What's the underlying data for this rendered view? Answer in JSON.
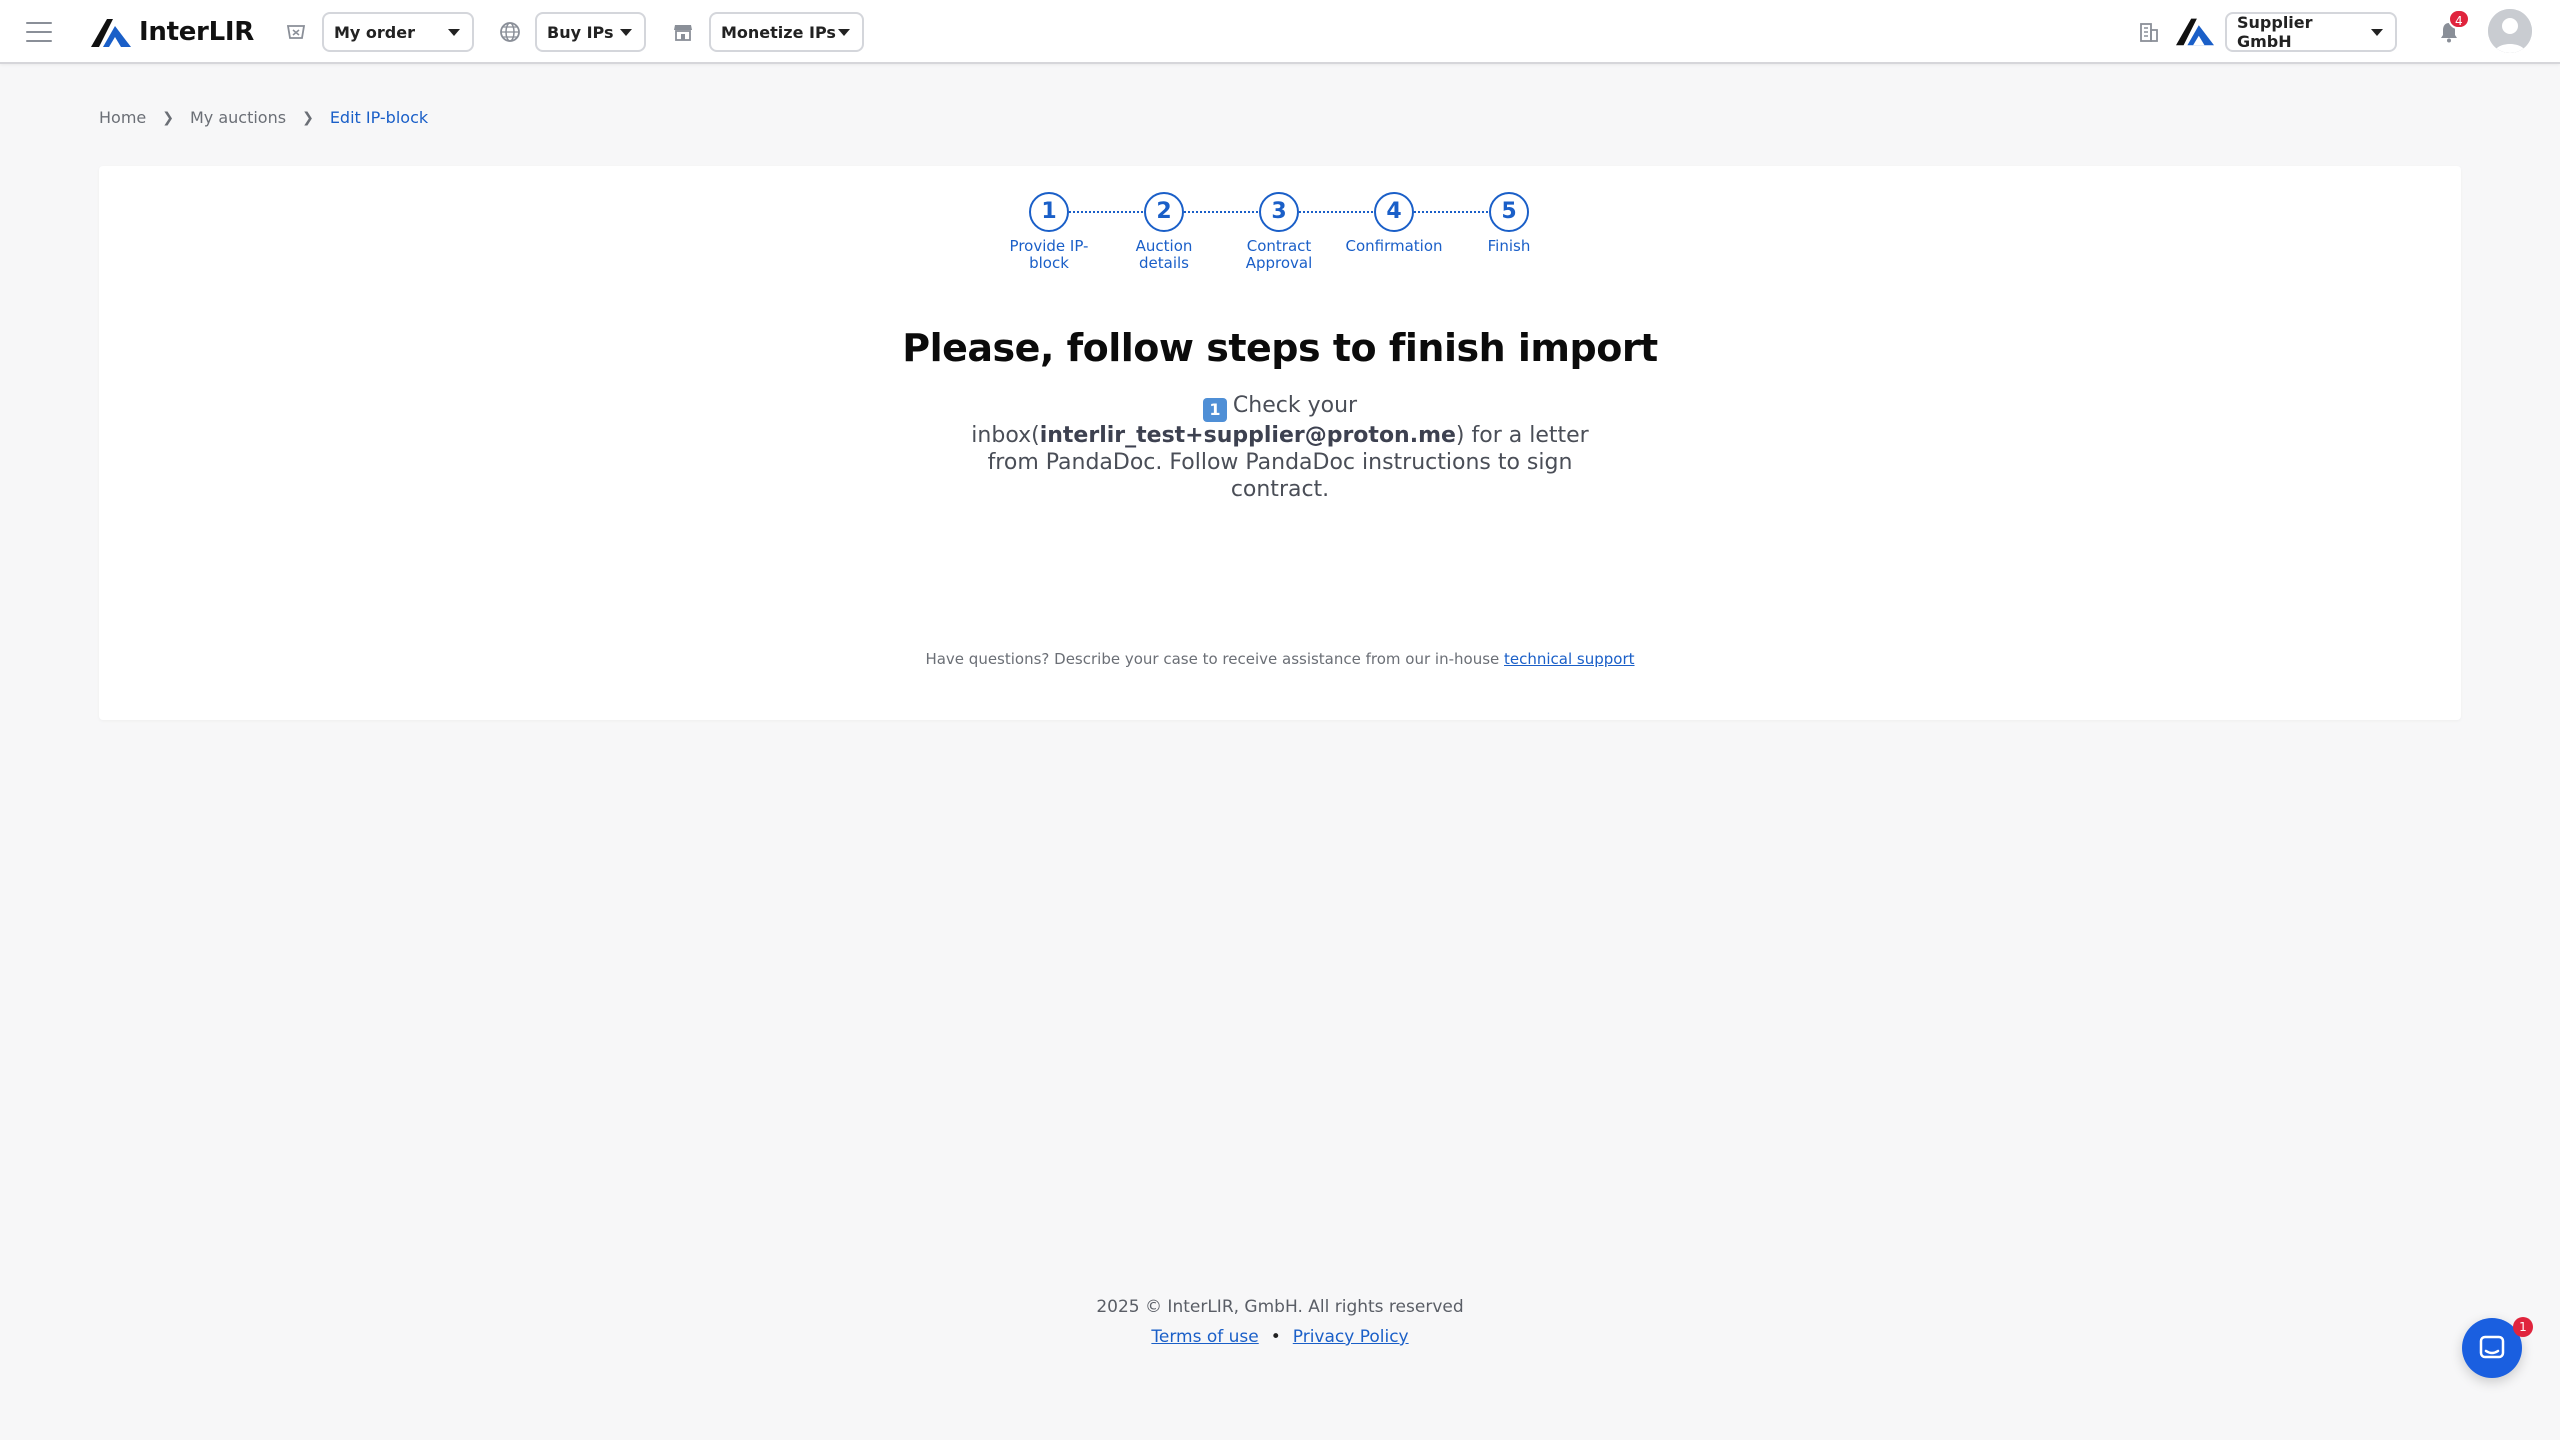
{
  "header": {
    "brand": "InterLIR",
    "my_order": "My order",
    "buy_ips": "Buy IPs",
    "monetize_ips": "Monetize IPs",
    "company": "Supplier GmbH",
    "notifications_count": "4"
  },
  "breadcrumb": {
    "home": "Home",
    "my_auctions": "My auctions",
    "current": "Edit IP-block"
  },
  "steps": [
    {
      "number": "1",
      "label": "Provide IP-block"
    },
    {
      "number": "2",
      "label": "Auction details"
    },
    {
      "number": "3",
      "label": "Contract Approval"
    },
    {
      "number": "4",
      "label": "Confirmation"
    },
    {
      "number": "5",
      "label": "Finish"
    }
  ],
  "main": {
    "title": "Please, follow steps to finish import",
    "instruction_num": "1",
    "instruction_prefix": "Check your inbox(",
    "email": "interlir_test+supplier@proton.me",
    "instruction_suffix": ") for a letter from PandaDoc. Follow PandaDoc instructions to sign contract.",
    "help_text": "Have questions? Describe your case to receive assistance from our in-house ",
    "help_link": "technical support"
  },
  "footer": {
    "copyright": "2025 © InterLIR, GmbH. All rights reserved",
    "terms": "Terms of use",
    "bullet": "•",
    "privacy": "Privacy Policy"
  },
  "chat": {
    "badge": "1"
  },
  "colors": {
    "accent": "#1a5fc8",
    "badge": "#e0243d",
    "chat": "#1a5fe0"
  }
}
